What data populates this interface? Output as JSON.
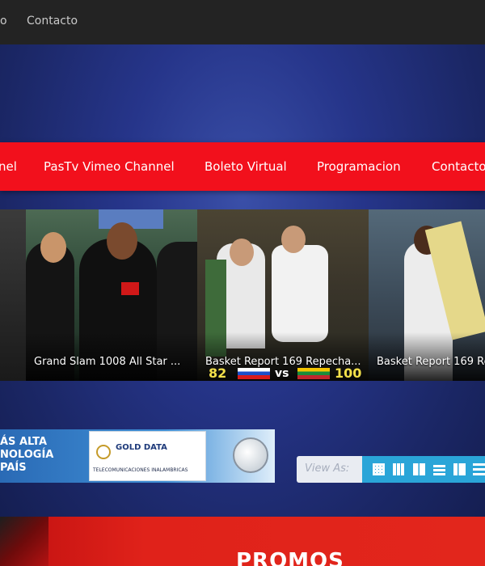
{
  "topnav": {
    "items": [
      {
        "label": "o"
      },
      {
        "label": "Contacto"
      }
    ]
  },
  "mainnav": {
    "items": [
      {
        "label": "nel"
      },
      {
        "label": "PasTv Vimeo Channel"
      },
      {
        "label": "Boleto Virtual"
      },
      {
        "label": "Programacion"
      },
      {
        "label": "Contacto"
      }
    ]
  },
  "carousel": {
    "slides": [
      {
        "caption": "Grand Slam 1008 All Star ..."
      },
      {
        "caption": "Basket Report 169 Repecha..."
      },
      {
        "caption": "Basket Report 169 Re"
      }
    ],
    "scoreboard": {
      "left": "82",
      "vs": "vs",
      "right": "100"
    }
  },
  "banner": {
    "slogan_lines": [
      "ÁS ALTA",
      "NOLOGÍA",
      "PAÍS"
    ],
    "logo_name": "GOLD DATA",
    "logo_tagline": "TELECOMUNICACIONES INALAMBRICAS"
  },
  "viewbar": {
    "label": "View As:",
    "icons": [
      "grid-small-icon",
      "grid-medium-icon",
      "grid-large-icon",
      "list-thumb-icon",
      "list-grid-icon",
      "list-icon"
    ]
  },
  "promos": {
    "title": "PROMOS"
  },
  "colors": {
    "topbar": "#232323",
    "nav_red": "#f2101c",
    "background_blue": "#26358a",
    "viewbar_accent": "#2aa5d8"
  }
}
